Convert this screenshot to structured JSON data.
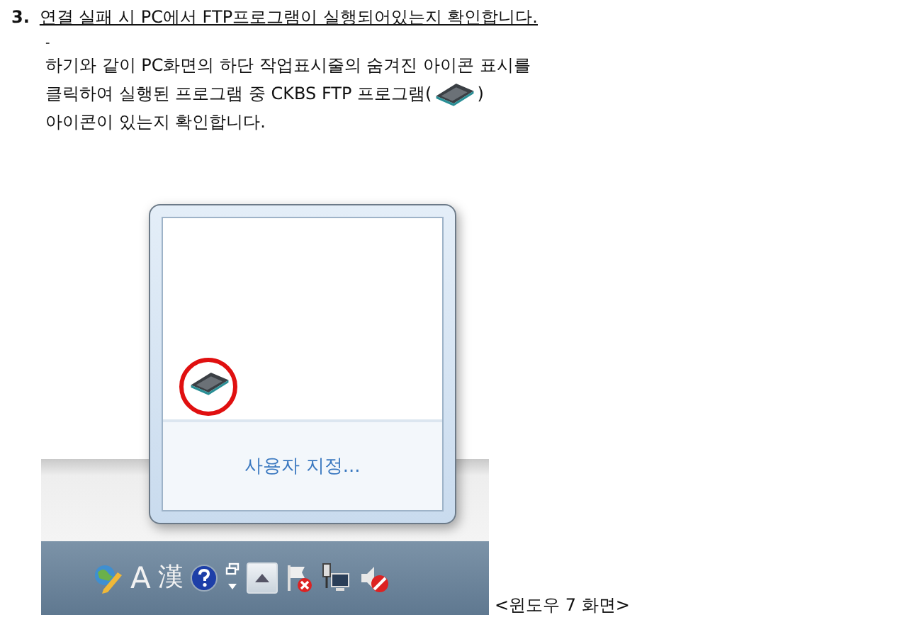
{
  "heading": {
    "number": "3.",
    "text": "연결 실패 시 PC에서 FTP프로그램이 실행되어있는지 확인합니다."
  },
  "dash": "-",
  "instructions": [
    {
      "kind": "text",
      "text": "하기와 같이 PC화면의 하단 작업표시줄의 숨겨진 아이콘 표시를"
    },
    {
      "kind": "text_with_icon",
      "before": "클릭하여 실행된 프로그램 중 CKBS FTP 프로그램(",
      "after": ")"
    },
    {
      "kind": "text",
      "text": "아이콘이 있는지 확인합니다."
    }
  ],
  "screenshot": {
    "popup": {
      "customize_link": "사용자 지정..."
    },
    "taskbar": {
      "input_mode": "A",
      "hanja": "漢"
    }
  },
  "caption": "<윈도우 7 화면>"
}
